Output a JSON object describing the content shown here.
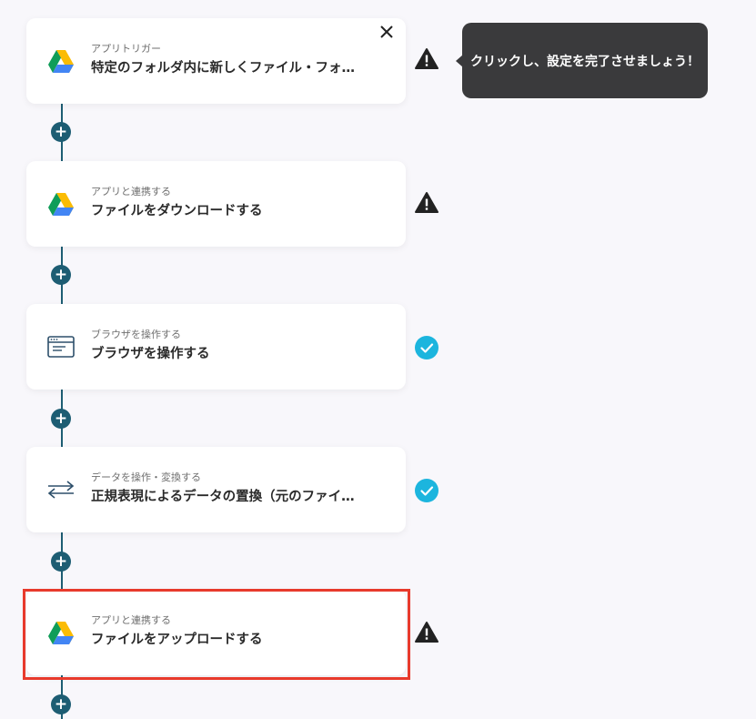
{
  "flow": {
    "steps": [
      {
        "subtitle": "アプリトリガー",
        "title": "特定のフォルダ内に新しくファイル・フォ…",
        "icon": "google-drive-icon",
        "status": "warning"
      },
      {
        "subtitle": "アプリと連携する",
        "title": "ファイルをダウンロードする",
        "icon": "google-drive-icon",
        "status": "warning"
      },
      {
        "subtitle": "ブラウザを操作する",
        "title": "ブラウザを操作する",
        "icon": "browser-window-icon",
        "status": "complete"
      },
      {
        "subtitle": "データを操作・変換する",
        "title": "正規表現によるデータの置換（元のファイ…",
        "icon": "convert-arrows-icon",
        "status": "complete"
      },
      {
        "subtitle": "アプリと連携する",
        "title": "ファイルをアップロードする",
        "icon": "google-drive-icon",
        "status": "warning"
      }
    ],
    "add_symbol": "+"
  },
  "tooltip": {
    "text": "クリックし、設定を完了させましょう！"
  },
  "colors": {
    "connector": "#1d5d73",
    "warning": "#222222",
    "complete": "#1cb5de",
    "highlight": "#e83a2c",
    "tooltip_bg": "#3a3a3c"
  }
}
